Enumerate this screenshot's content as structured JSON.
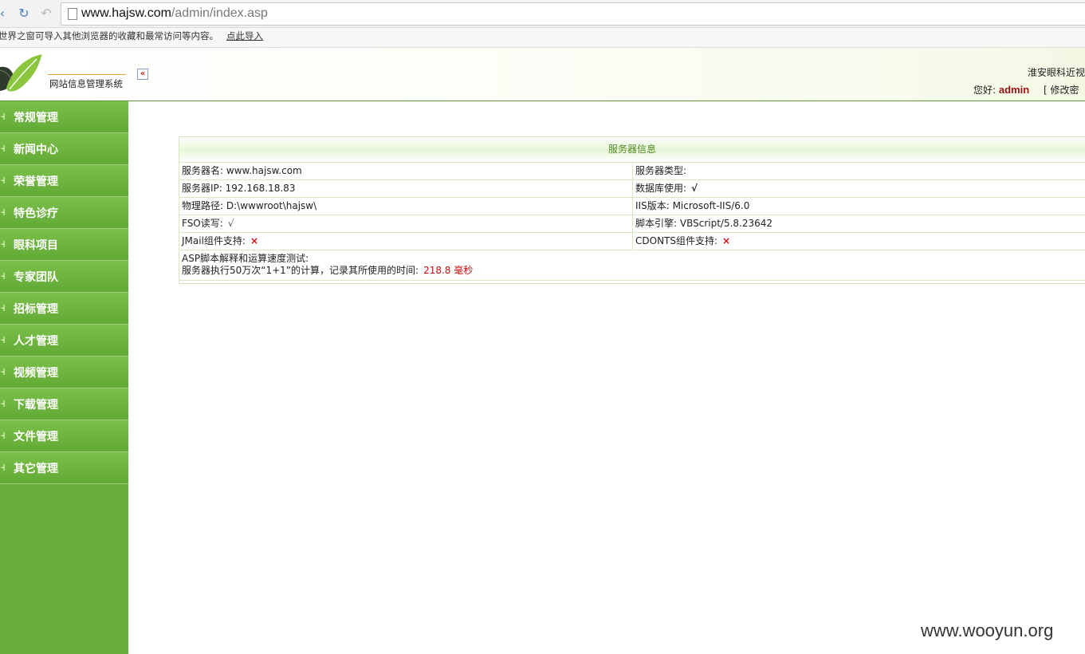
{
  "browser": {
    "url_host": "www.hajsw.com",
    "url_path": "/admin/index.asp",
    "infobar_text": "世界之窗可导入其他浏览器的收藏和最常访问等内容。",
    "infobar_link": "点此导入"
  },
  "header": {
    "system_name": "网站信息管理系统",
    "site_name": "淮安眼科近视",
    "greeting": "您好:",
    "username": "admin",
    "change_password": "[ 修改密"
  },
  "sidebar": {
    "items": [
      {
        "label": "常规管理"
      },
      {
        "label": "新闻中心"
      },
      {
        "label": "荣誉管理"
      },
      {
        "label": "特色诊疗"
      },
      {
        "label": "眼科项目"
      },
      {
        "label": "专家团队"
      },
      {
        "label": "招标管理"
      },
      {
        "label": "人才管理"
      },
      {
        "label": "视频管理"
      },
      {
        "label": "下载管理"
      },
      {
        "label": "文件管理"
      },
      {
        "label": "其它管理"
      }
    ]
  },
  "server_info": {
    "title": "服务器信息",
    "server_name_label": "服务器名:",
    "server_name": "www.hajsw.com",
    "server_type_label": "服务器类型:",
    "server_type": "",
    "server_ip_label": "服务器IP:",
    "server_ip": "192.168.18.83",
    "db_label": "数据库使用:",
    "db_mark": "√",
    "path_label": "物理路径:",
    "path": "D:\\wwwroot\\hajsw\\",
    "iis_label": "IIS版本:",
    "iis": "Microsoft-IIS/6.0",
    "fso_label": "FSO读写:",
    "fso_mark": "√",
    "script_label": "脚本引擎:",
    "script": "VBScript/5.8.23642",
    "jmail_label": "JMail组件支持:",
    "jmail_mark": "×",
    "cdonts_label": "CDONTS组件支持:",
    "cdonts_mark": "×",
    "speed_test_label": "ASP脚本解释和运算速度测试:",
    "speed_test_desc": "服务器执行50万次“1+1”的计算，记录其所使用的时间:",
    "speed_time": "218.8 毫秒"
  },
  "watermark": "www.wooyun.org"
}
